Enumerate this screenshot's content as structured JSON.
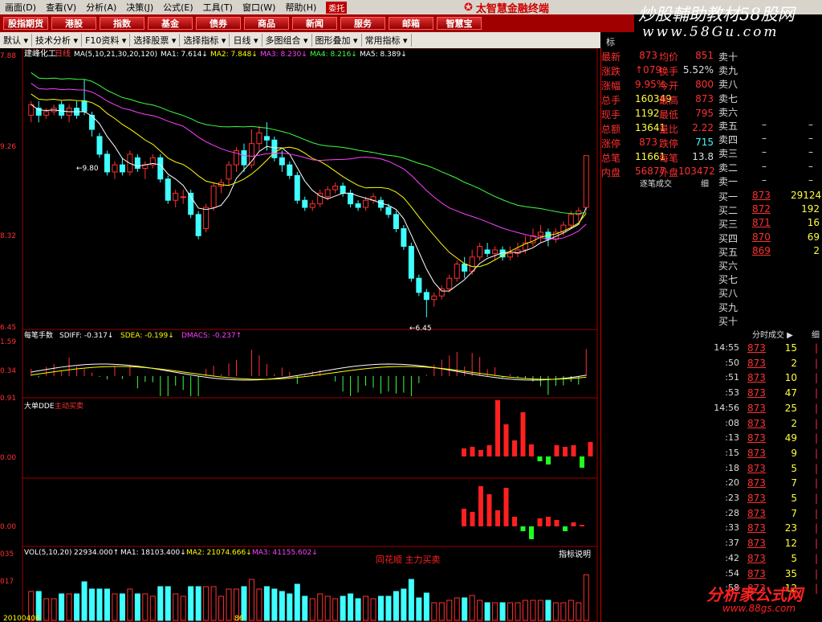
{
  "menu": {
    "items": [
      "画面(D)",
      "查看(V)",
      "分析(A)",
      "决策(J)",
      "公式(E)",
      "工具(T)",
      "窗口(W)",
      "帮助(H)"
    ],
    "tag": "委托"
  },
  "brand": "太智慧金融终端",
  "nav": [
    "股指期货",
    "港股",
    "指数",
    "基金",
    "债券",
    "商品",
    "新闻",
    "服务",
    "邮箱",
    "智慧宝"
  ],
  "toolbar": [
    "默认",
    "技术分析",
    "F10资料",
    "选择股票",
    "选择指标",
    "日线",
    "多图组合",
    "图形叠加",
    "常用指标"
  ],
  "watermark": {
    "top": "炒股輔助教材58股网",
    "url": "www.58Gu.com",
    "bottom": "分析家公式网",
    "bottom_url": "www.88gs.com"
  },
  "main": {
    "stock": "建峰化工",
    "period": "日线",
    "ma_header": "MA(5,10,21,30,20,120)",
    "ma": [
      {
        "label": "MA1: 7.614↓",
        "color": "#ffffff"
      },
      {
        "label": "MA2: 7.848↓",
        "color": "#ffff00"
      },
      {
        "label": "MA3: 8.230↓",
        "color": "#ff40ff"
      },
      {
        "label": "MA4: 8.216↓",
        "color": "#40ff40"
      },
      {
        "label": "MA5: 8.389↓",
        "color": "#ffffff"
      }
    ],
    "axis": [
      "7.88",
      "9.26",
      "8.32",
      "6.45"
    ],
    "high_label": "9.80",
    "low_label": "6.45"
  },
  "ind1": {
    "title": "每笔手数",
    "values": [
      {
        "label": "SDIFF: -0.317↓",
        "color": "#ffffff"
      },
      {
        "label": "SDEA: -0.199↓",
        "color": "#ffff00"
      },
      {
        "label": "DMACS: -0.237↑",
        "color": "#ff40ff"
      }
    ],
    "axis": [
      "1.59",
      "0.34",
      "0.91"
    ]
  },
  "ind2": {
    "title": "大单DDE",
    "sub": "主动买卖",
    "axis": "0.00"
  },
  "ind3": {
    "axis": "0.00"
  },
  "vol": {
    "header": "VOL(5,10,20)",
    "v": "22934.000↑",
    "ma": [
      {
        "label": "MA1: 18103.400↓",
        "color": "#ffffff"
      },
      {
        "label": "MA2: 21074.666↓",
        "color": "#ffff00"
      },
      {
        "label": "MA3: 41155.602↓",
        "color": "#ff40ff"
      }
    ],
    "axis": [
      "035",
      "017"
    ],
    "watermark": "同花顺 主力买卖",
    "note": "指标说明",
    "date": "20100406",
    "date2": "86"
  },
  "right": {
    "tab": "标",
    "quote_left": [
      [
        "最新",
        "873"
      ],
      [
        "涨跌",
        "↑079"
      ],
      [
        "涨幅",
        "9.95%"
      ],
      [
        "总手",
        "160349"
      ],
      [
        "现手",
        "1192"
      ],
      [
        "总额",
        "13641"
      ],
      [
        "涨停",
        "873"
      ],
      [
        "总笔",
        "11661"
      ],
      [
        "内盘",
        "56877"
      ]
    ],
    "quote_mid": [
      [
        "均价",
        "851"
      ],
      [
        "换手",
        "5.52%"
      ],
      [
        "今开",
        "800"
      ],
      [
        "最高",
        "873"
      ],
      [
        "最低",
        "795"
      ],
      [
        "量比",
        "2.22"
      ],
      [
        "跌停",
        "715"
      ],
      [
        "每笔",
        "13.8"
      ],
      [
        "外盘",
        "103472"
      ]
    ],
    "sell": [
      [
        "卖十",
        "",
        ""
      ],
      [
        "卖九",
        "",
        ""
      ],
      [
        "卖八",
        "",
        ""
      ],
      [
        "卖七",
        "",
        ""
      ],
      [
        "卖六",
        "",
        ""
      ],
      [
        "卖五",
        "–",
        "–"
      ],
      [
        "卖四",
        "–",
        "–"
      ],
      [
        "卖三",
        "–",
        "–"
      ],
      [
        "卖二",
        "–",
        "–"
      ],
      [
        "卖一",
        "–",
        "–"
      ]
    ],
    "buy": [
      [
        "买一",
        "873",
        "29124"
      ],
      [
        "买二",
        "872",
        "192"
      ],
      [
        "买三",
        "871",
        "16"
      ],
      [
        "买四",
        "870",
        "69"
      ],
      [
        "买五",
        "869",
        "2"
      ],
      [
        "买六",
        "",
        ""
      ],
      [
        "买七",
        "",
        ""
      ],
      [
        "买八",
        "",
        ""
      ],
      [
        "买九",
        "",
        ""
      ],
      [
        "买十",
        "",
        ""
      ]
    ],
    "order_title": "逐笔成交",
    "order_btn": "细",
    "ticks_title": "分时成交",
    "ticks_btn": "细",
    "ticks": [
      [
        "14:55",
        "873",
        "15"
      ],
      [
        ":50",
        "873",
        "2"
      ],
      [
        ":51",
        "873",
        "10"
      ],
      [
        ":53",
        "873",
        "47"
      ],
      [
        "14:56",
        "873",
        "25"
      ],
      [
        ":08",
        "873",
        "2"
      ],
      [
        ":13",
        "873",
        "49"
      ],
      [
        ":15",
        "873",
        "9"
      ],
      [
        ":18",
        "873",
        "5"
      ],
      [
        ":20",
        "873",
        "7"
      ],
      [
        ":23",
        "873",
        "5"
      ],
      [
        ":28",
        "873",
        "7"
      ],
      [
        ":33",
        "873",
        "23"
      ],
      [
        ":37",
        "873",
        "12"
      ],
      [
        ":42",
        "873",
        "5"
      ],
      [
        ":54",
        "873",
        "35"
      ],
      [
        ":58",
        "873",
        "12"
      ]
    ]
  },
  "chart_data": {
    "type": "candlestick",
    "candles": [
      [
        9.3,
        9.45,
        9.2,
        9.5
      ],
      [
        9.4,
        9.3,
        9.2,
        9.5
      ],
      [
        9.3,
        9.35,
        9.25,
        9.4
      ],
      [
        9.35,
        9.4,
        9.3,
        9.45
      ],
      [
        9.45,
        9.3,
        9.25,
        9.5
      ],
      [
        9.3,
        9.4,
        9.2,
        9.45
      ],
      [
        9.4,
        9.3,
        9.25,
        9.5
      ],
      [
        9.5,
        9.35,
        9.3,
        9.8
      ],
      [
        9.3,
        9.1,
        9.0,
        9.35
      ],
      [
        9.0,
        8.75,
        8.7,
        9.05
      ],
      [
        8.75,
        8.5,
        8.45,
        8.8
      ],
      [
        8.5,
        8.6,
        8.4,
        8.65
      ],
      [
        8.6,
        8.5,
        8.45,
        8.7
      ],
      [
        8.5,
        8.75,
        8.45,
        8.8
      ],
      [
        8.7,
        8.55,
        8.5,
        8.75
      ],
      [
        8.55,
        8.6,
        8.4,
        8.65
      ],
      [
        8.6,
        8.7,
        8.55,
        8.75
      ],
      [
        8.7,
        8.4,
        8.35,
        8.75
      ],
      [
        8.4,
        8.1,
        8.05,
        8.45
      ],
      [
        8.1,
        8.2,
        8.0,
        8.25
      ],
      [
        8.15,
        8.15,
        8.05,
        8.25
      ],
      [
        8.2,
        7.9,
        7.85,
        8.25
      ],
      [
        7.9,
        7.6,
        7.55,
        7.95
      ],
      [
        7.7,
        8.0,
        7.65,
        8.05
      ],
      [
        8.0,
        8.3,
        7.95,
        8.35
      ],
      [
        8.3,
        8.35,
        8.2,
        8.4
      ],
      [
        8.4,
        8.6,
        8.3,
        8.65
      ],
      [
        8.6,
        8.8,
        8.5,
        8.85
      ],
      [
        8.8,
        8.6,
        8.5,
        8.9
      ],
      [
        8.6,
        8.9,
        8.55,
        9.1
      ],
      [
        8.9,
        9.05,
        8.8,
        9.15
      ],
      [
        9.0,
        8.95,
        8.8,
        9.2
      ],
      [
        8.95,
        8.7,
        8.65,
        9.0
      ],
      [
        8.7,
        8.6,
        8.5,
        8.8
      ],
      [
        8.6,
        8.45,
        8.4,
        8.65
      ],
      [
        8.45,
        8.1,
        8.05,
        8.5
      ],
      [
        8.1,
        8.0,
        7.95,
        8.15
      ],
      [
        8.0,
        8.05,
        7.95,
        8.1
      ],
      [
        8.05,
        8.2,
        8.0,
        8.25
      ],
      [
        8.15,
        8.25,
        8.1,
        8.3
      ],
      [
        8.25,
        8.3,
        8.2,
        8.35
      ],
      [
        8.3,
        8.2,
        8.15,
        8.35
      ],
      [
        8.2,
        8.05,
        8.0,
        8.25
      ],
      [
        8.05,
        8.0,
        7.95,
        8.1
      ],
      [
        8.0,
        8.1,
        7.95,
        8.15
      ],
      [
        8.1,
        8.15,
        8.05,
        8.2
      ],
      [
        8.1,
        8.0,
        7.95,
        8.15
      ],
      [
        8.0,
        7.9,
        7.85,
        8.05
      ],
      [
        7.9,
        7.7,
        7.65,
        7.95
      ],
      [
        7.7,
        7.45,
        7.4,
        7.75
      ],
      [
        7.45,
        7.0,
        6.95,
        7.5
      ],
      [
        7.0,
        6.8,
        6.75,
        7.05
      ],
      [
        6.8,
        6.7,
        6.45,
        6.85
      ],
      [
        6.7,
        6.75,
        6.6,
        6.8
      ],
      [
        6.75,
        6.85,
        6.7,
        6.9
      ],
      [
        6.85,
        7.0,
        6.8,
        7.05
      ],
      [
        7.0,
        7.2,
        6.95,
        7.25
      ],
      [
        7.2,
        7.1,
        7.0,
        7.3
      ],
      [
        7.1,
        7.3,
        7.05,
        7.4
      ],
      [
        7.3,
        7.45,
        7.25,
        7.5
      ],
      [
        7.4,
        7.35,
        7.3,
        7.5
      ],
      [
        7.35,
        7.4,
        7.25,
        7.45
      ],
      [
        7.4,
        7.3,
        7.25,
        7.45
      ],
      [
        7.3,
        7.35,
        7.25,
        7.45
      ],
      [
        7.35,
        7.4,
        7.3,
        7.5
      ],
      [
        7.4,
        7.5,
        7.35,
        7.6
      ],
      [
        7.5,
        7.6,
        7.45,
        7.7
      ],
      [
        7.6,
        7.65,
        7.5,
        7.75
      ],
      [
        7.65,
        7.55,
        7.45,
        7.7
      ],
      [
        7.55,
        7.65,
        7.5,
        7.7
      ],
      [
        7.65,
        7.75,
        7.6,
        7.8
      ],
      [
        7.75,
        7.9,
        7.7,
        7.95
      ],
      [
        7.9,
        7.95,
        7.8,
        8.0
      ],
      [
        8.0,
        8.73,
        7.95,
        8.73
      ]
    ],
    "ylim": [
      6.3,
      10.2
    ]
  }
}
